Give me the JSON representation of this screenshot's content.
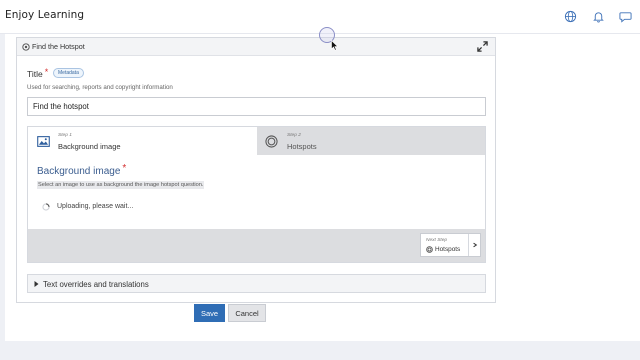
{
  "app": {
    "title": "Enjoy Learning",
    "icons": [
      "globe-icon",
      "bell-icon",
      "chat-icon"
    ],
    "accent_color": "#2f6db5"
  },
  "editor": {
    "header_title": "Find the Hotspot",
    "title_label": "Title",
    "required_mark": "*",
    "metadata_badge": "Metadata",
    "help_text": "Used for searching, reports and copyright information",
    "title_value": "Find the hotspot",
    "steps": [
      {
        "small": "Step 1",
        "name": "Background image",
        "icon": "image-icon",
        "active": true
      },
      {
        "small": "Step 2",
        "name": "Hotspots",
        "icon": "target-icon",
        "active": false
      }
    ],
    "section_title": "Background image",
    "section_hint": "Select an image to use as background the image hotspot question.",
    "uploading_text": "Uploading, please wait...",
    "next_step": {
      "small": "Next Step",
      "name": "Hotspots"
    },
    "overrides_label": "Text overrides and translations"
  },
  "actions": {
    "save_label": "Save",
    "cancel_label": "Cancel"
  }
}
